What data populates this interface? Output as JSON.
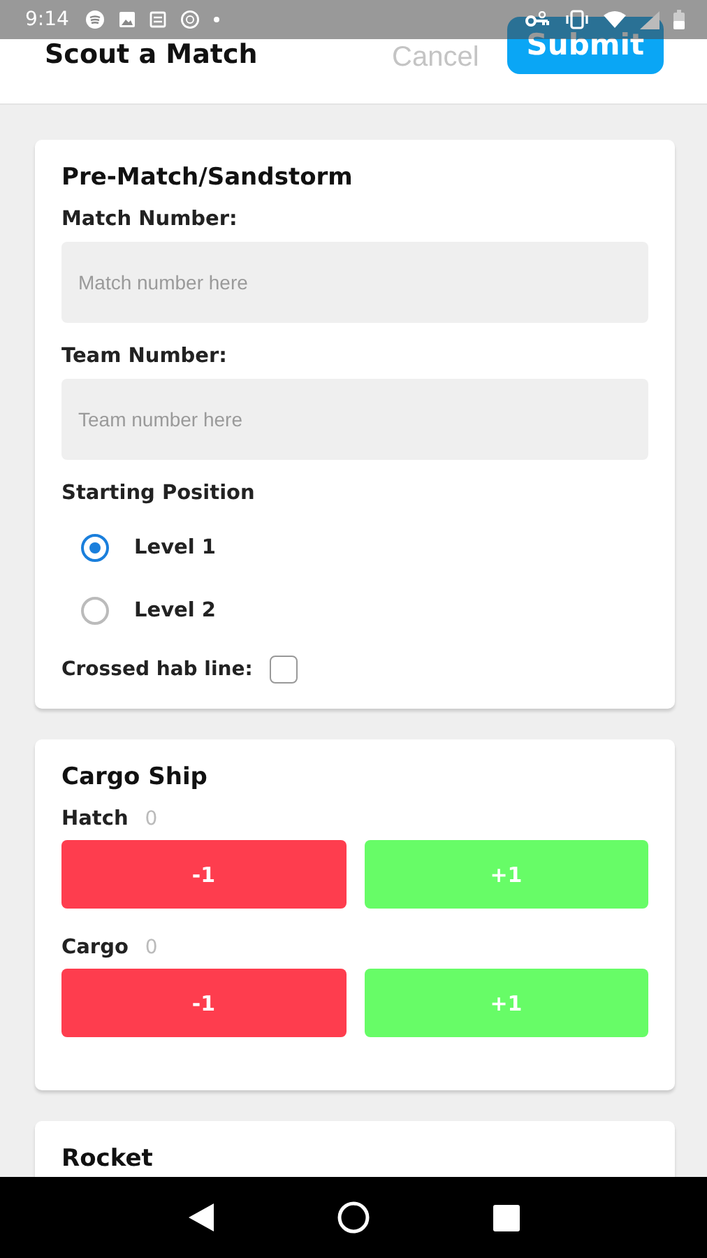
{
  "status_bar": {
    "time": "9:14"
  },
  "header": {
    "title": "Scout a Match",
    "cancel": "Cancel",
    "submit": "Submit"
  },
  "sections": [
    {
      "title": "Pre-Match/Sandstorm",
      "items": [
        {
          "kind": "field",
          "label": "Match Number:",
          "placeholder": "Match number here"
        },
        {
          "kind": "field",
          "label": "Team Number:",
          "placeholder": "Team number here"
        },
        {
          "kind": "radio",
          "label": "Starting Position",
          "options": [
            {
              "label": "Level 1",
              "selected": true
            },
            {
              "label": "Level 2",
              "selected": false
            }
          ]
        },
        {
          "kind": "checkbox",
          "label": "Crossed hab line:",
          "checked": false
        }
      ]
    },
    {
      "title": "Cargo Ship",
      "items": [
        {
          "kind": "counter",
          "label": "Hatch",
          "count": "0",
          "minus": "-1",
          "plus": "+1"
        },
        {
          "kind": "counter",
          "label": "Cargo",
          "count": "0",
          "minus": "-1",
          "plus": "+1"
        }
      ]
    },
    {
      "title": "Rocket"
    }
  ]
}
